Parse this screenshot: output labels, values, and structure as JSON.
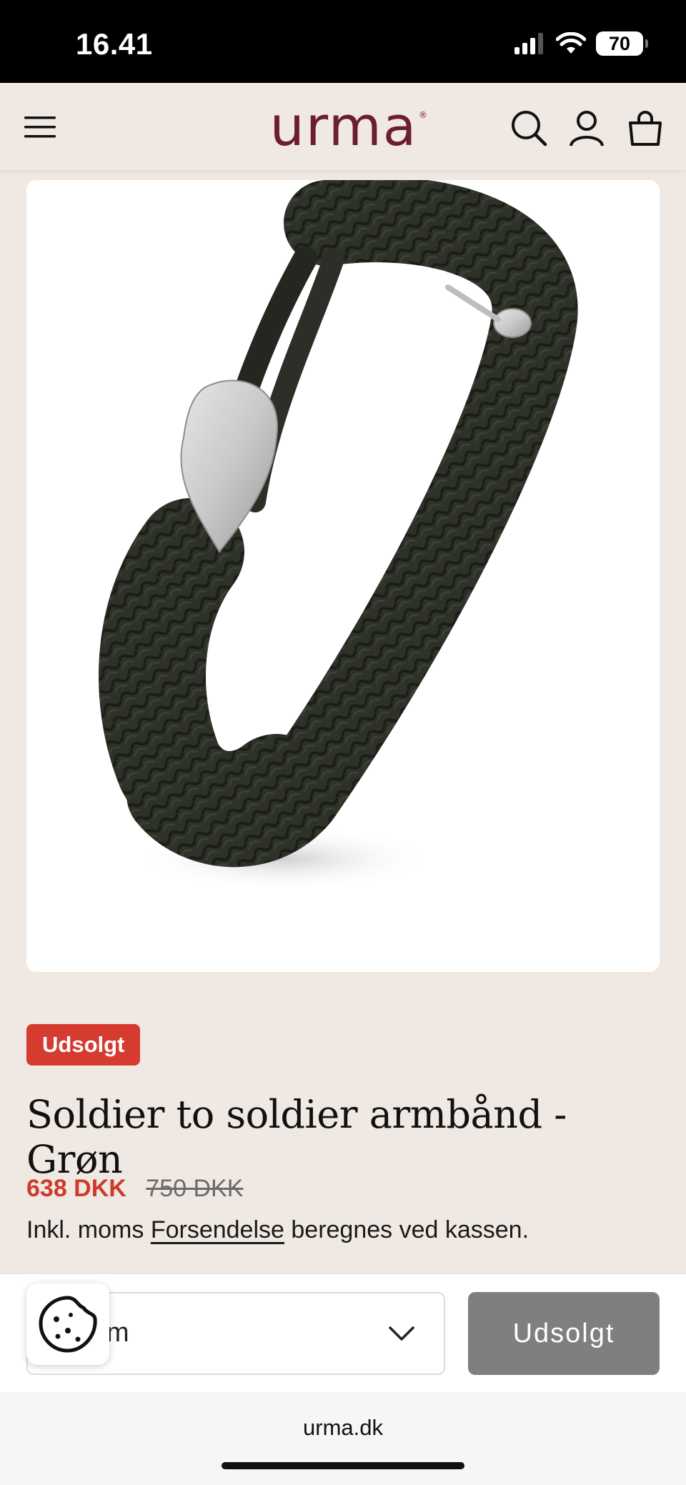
{
  "status": {
    "time": "16.41",
    "battery": "70"
  },
  "header": {
    "logo": "urma",
    "logo_mark": "®",
    "icons": [
      "menu-icon",
      "search-icon",
      "account-icon",
      "cart-icon"
    ]
  },
  "product": {
    "image_alt": "Braided dark green cord bracelet with silver heart clasp",
    "badge": "Udsolgt",
    "title": "Soldier to soldier armbånd - Grøn",
    "price_sale": "638 DKK",
    "price_original": "750 DKK",
    "tax_prefix": "Inkl. moms",
    "shipping_link": "Forsendelse",
    "tax_suffix": "beregnes ved kassen."
  },
  "purchase_bar": {
    "size_value_visible": "m",
    "button_label": "Udsolgt"
  },
  "colors": {
    "background": "#f0e9e3",
    "brand": "#6b1d31",
    "sale": "#cf3a2c",
    "badge": "#d63b2f",
    "disabled_button": "#7f7f7f"
  },
  "browser": {
    "url": "urma.dk"
  }
}
